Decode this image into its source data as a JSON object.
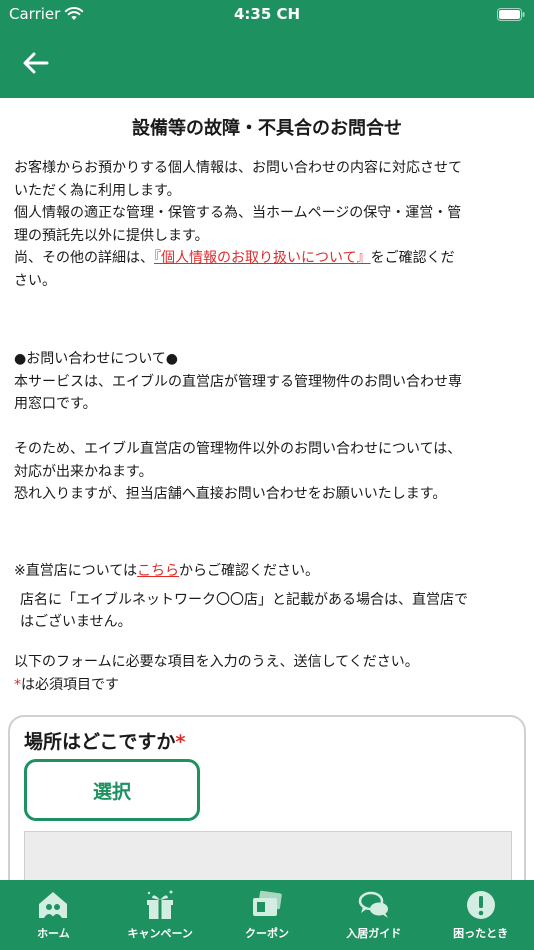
{
  "status_bar": {
    "carrier": "Carrier",
    "time": "4:35 CH"
  },
  "page": {
    "title": "設備等の故障・不具合のお問合せ",
    "privacy": {
      "line1": "お客様からお預かりする個人情報は、お問い合わせの内容に対応させて",
      "line2": "いただく為に利用します。",
      "line3": "個人情報の適正な管理・保管する為、当ホームページの保守・運営・管",
      "line4": "理の預託先以外に提供します。",
      "line5_before": "尚、その他の詳細は、",
      "line5_link": "『個人情報のお取り扱いについて』",
      "line5_after": "をご確認くだ",
      "line6": "さい。"
    },
    "inquiry": {
      "heading": "●お問い合わせについて●",
      "line1": "本サービスは、エイブルの直営店が管理する管理物件のお問い合わせ専",
      "line2": "用窓口です。",
      "line3": "そのため、エイブル直営店の管理物件以外のお問い合わせについては、",
      "line4": "対応が出来かねます。",
      "line5": "恐れ入りますが、担当店舗へ直接お問い合わせをお願いいたします。"
    },
    "store": {
      "before": "※直営店については",
      "link": "こちら",
      "after": "からご確認ください。",
      "note1": "店名に「エイブルネットワーク〇〇店」と記載がある場合は、直営店で",
      "note2": "はございません。"
    },
    "form_intro": {
      "line1": "以下のフォームに必要な項目を入力のうえ、送信してください。",
      "required_mark": "*",
      "required_text": "は必須項目です"
    }
  },
  "form": {
    "location_label": "場所はどこですか",
    "required_mark": "*",
    "select_button": "選択"
  },
  "tabs": [
    {
      "label": "ホーム",
      "icon": "home-icon"
    },
    {
      "label": "キャンペーン",
      "icon": "gift-icon"
    },
    {
      "label": "クーポン",
      "icon": "coupon-icon"
    },
    {
      "label": "入居ガイド",
      "icon": "chat-icon"
    },
    {
      "label": "困ったとき",
      "icon": "alert-icon"
    }
  ],
  "colors": {
    "brand": "#1e9160",
    "link": "#e02b2b",
    "text": "#1a1a1a"
  }
}
